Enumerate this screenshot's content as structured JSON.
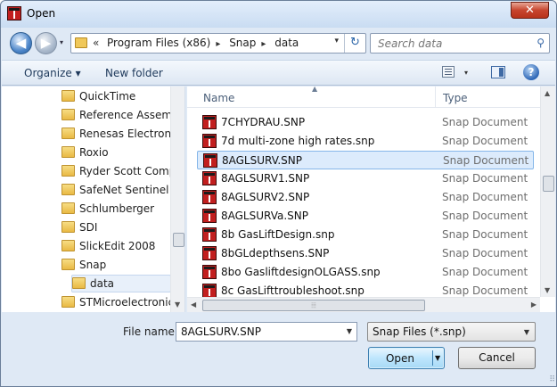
{
  "window": {
    "title": "Open",
    "close_glyph": "✕"
  },
  "nav": {
    "back_glyph": "◀",
    "forward_glyph": "▶",
    "history_glyph": "▾"
  },
  "address": {
    "chevron": "«",
    "crumbs": [
      "Program Files (x86)",
      "Snap",
      "data"
    ],
    "separator_glyph": "▸",
    "dropdown_glyph": "▾",
    "refresh_glyph": "↻"
  },
  "search": {
    "placeholder": "Search data",
    "icon_glyph": "⚲"
  },
  "toolbar": {
    "organize_label": "Organize ▾",
    "new_folder_label": "New folder",
    "views_drop_glyph": "▾",
    "help_glyph": "?"
  },
  "nav_pane": {
    "items": [
      {
        "label": "QuickTime"
      },
      {
        "label": "Reference Assembl"
      },
      {
        "label": "Renesas Electronics"
      },
      {
        "label": "Roxio"
      },
      {
        "label": "Ryder Scott Compa"
      },
      {
        "label": "SafeNet Sentinel"
      },
      {
        "label": "Schlumberger"
      },
      {
        "label": "SDI"
      },
      {
        "label": "SlickEdit 2008"
      },
      {
        "label": "Snap"
      },
      {
        "label": "data"
      },
      {
        "label": "STMicroelectronics"
      }
    ],
    "selected_label": "data",
    "scroll_down_glyph": "▼"
  },
  "file_pane": {
    "columns": {
      "name": "Name",
      "type": "Type",
      "sort_glyph": "▲"
    },
    "rows": [
      {
        "name": "7CHYDRAU.SNP",
        "type": "Snap Document"
      },
      {
        "name": "7d multi-zone high rates.snp",
        "type": "Snap Document"
      },
      {
        "name": "8AGLSURV.SNP",
        "type": "Snap Document"
      },
      {
        "name": "8AGLSURV1.SNP",
        "type": "Snap Document"
      },
      {
        "name": "8AGLSURV2.SNP",
        "type": "Snap Document"
      },
      {
        "name": "8AGLSURVa.SNP",
        "type": "Snap Document"
      },
      {
        "name": "8b GasLiftDesign.snp",
        "type": "Snap Document"
      },
      {
        "name": "8bGLdepthsens.SNP",
        "type": "Snap Document"
      },
      {
        "name": "8bo GasliftdesignOLGASS.snp",
        "type": "Snap Document"
      },
      {
        "name": "8c GasLifttroubleshoot.snp",
        "type": "Snap Document"
      }
    ],
    "selected_name": "8AGLSURV.SNP",
    "scroll": {
      "up_glyph": "▲",
      "down_glyph": "▼",
      "left_glyph": "◀",
      "right_glyph": "▶",
      "grip_glyph": "⦙⦙⦙"
    }
  },
  "bottom": {
    "file_name_label": "File name:",
    "file_name_value": "8AGLSURV.SNP",
    "file_name_drop_glyph": "▼",
    "filter_value": "Snap Files (*.snp)",
    "filter_drop_glyph": "▼",
    "open_label": "Open",
    "open_drop_glyph": "▼",
    "cancel_label": "Cancel",
    "grip_glyph": "⠿"
  }
}
